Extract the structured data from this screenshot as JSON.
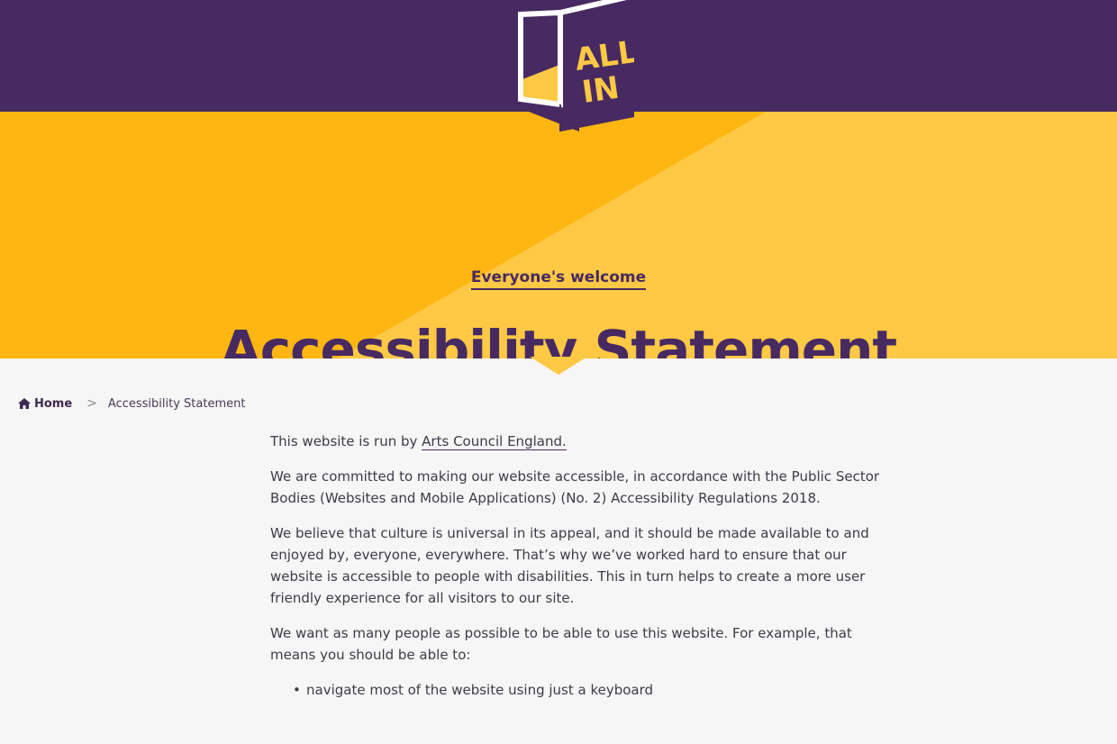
{
  "header": {
    "logo_line1": "ALL",
    "logo_line2": "IN"
  },
  "hero": {
    "tagline": "Everyone's welcome",
    "title": "Accessibility Statement",
    "colors": {
      "purple": "#472a61",
      "amber": "#ffb612",
      "amber_light": "#ffc845"
    }
  },
  "breadcrumb": {
    "home_label": "Home",
    "separator": ">",
    "current": "Accessibility Statement"
  },
  "content": {
    "p1_prefix": "This website is run by ",
    "p1_link": "Arts Council England.",
    "p2": "We are committed to making our website accessible, in accordance with the Public Sector Bodies (Websites and Mobile Applications) (No. 2) Accessibility Regulations 2018.",
    "p3": "We believe that culture is universal in its appeal, and it should be made available to and enjoyed by, everyone, everywhere. That’s why we’ve worked hard to ensure that our website is accessible to people with disabilities. This in turn helps to create a more user friendly experience for all visitors to our site.",
    "p4": "We want as many people as possible to be able to use this website. For example, that means you should be able to:",
    "list": [
      "navigate most of the website using just a keyboard"
    ]
  }
}
